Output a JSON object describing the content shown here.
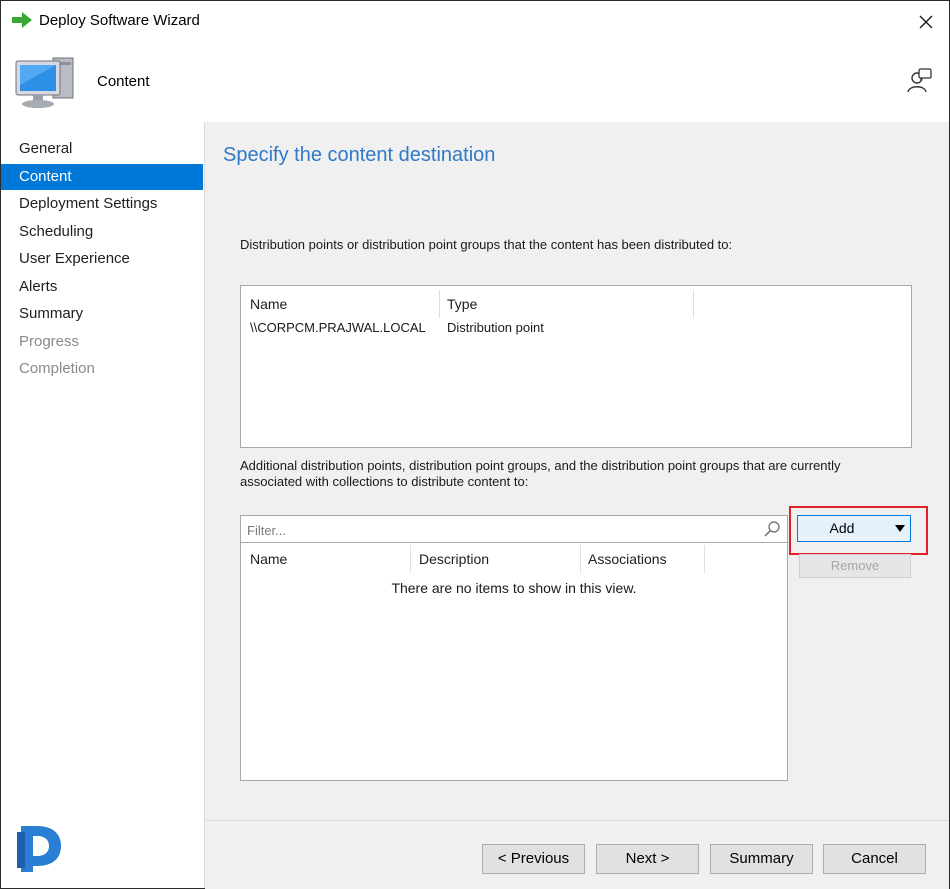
{
  "window": {
    "title": "Deploy Software Wizard",
    "close_glyph": "✕"
  },
  "header": {
    "title": "Content",
    "icon": "computer-monitor-icon",
    "help_icon": "help-person-icon"
  },
  "sidebar": {
    "items": [
      {
        "label": "General",
        "state": "normal"
      },
      {
        "label": "Content",
        "state": "active"
      },
      {
        "label": "Deployment Settings",
        "state": "normal"
      },
      {
        "label": "Scheduling",
        "state": "normal"
      },
      {
        "label": "User Experience",
        "state": "normal"
      },
      {
        "label": "Alerts",
        "state": "normal"
      },
      {
        "label": "Summary",
        "state": "normal"
      },
      {
        "label": "Progress",
        "state": "disabled"
      },
      {
        "label": "Completion",
        "state": "disabled"
      }
    ],
    "active_color": "#0078d7"
  },
  "main": {
    "heading": "Specify the content destination",
    "distributed_label": "Distribution points or distribution point groups that the content has been distributed to:",
    "distributed_list": {
      "columns": [
        "Name",
        "Type"
      ],
      "rows": [
        {
          "name": "\\\\CORPCM.PRAJWAL.LOCAL",
          "type": "Distribution point"
        }
      ]
    },
    "additional_label": "Additional distribution points, distribution point groups, and the distribution point groups that are currently associated with collections to distribute content to:",
    "filter_placeholder": "Filter...",
    "additional_list": {
      "columns": [
        "Name",
        "Description",
        "Associations"
      ],
      "empty_message": "There are no items to show in this view."
    },
    "add_button": "Add",
    "remove_button": "Remove",
    "highlight_color": "#e0232a"
  },
  "footer": {
    "previous": "< Previous",
    "next": "Next >",
    "summary": "Summary",
    "cancel": "Cancel"
  }
}
